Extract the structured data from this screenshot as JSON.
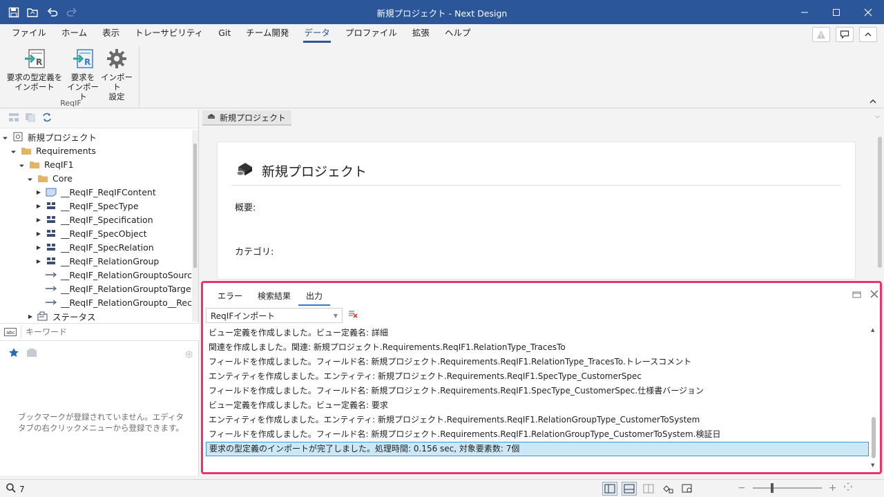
{
  "window": {
    "title": "新規プロジェクト - Next Design"
  },
  "qat": {
    "icons": [
      "save-icon",
      "open-project-icon",
      "undo-icon",
      "redo-icon"
    ]
  },
  "menu": {
    "tabs": [
      {
        "label": "ファイル"
      },
      {
        "label": "ホーム"
      },
      {
        "label": "表示"
      },
      {
        "label": "トレーサビリティ"
      },
      {
        "label": "Git"
      },
      {
        "label": "チーム開発"
      },
      {
        "label": "データ"
      },
      {
        "label": "プロファイル"
      },
      {
        "label": "拡張"
      },
      {
        "label": "ヘルプ"
      }
    ],
    "active": "データ"
  },
  "ribbon": {
    "group_label": "ReqIF",
    "commands": [
      {
        "line1": "要求の型定義を",
        "line2": "インポート"
      },
      {
        "line1": "要求を",
        "line2": "インポート"
      },
      {
        "line1": "インポート",
        "line2": "設定"
      }
    ]
  },
  "tree": {
    "items": [
      {
        "label": "新規プロジェクト",
        "level": 0,
        "expander": "open",
        "icon": "project-icon"
      },
      {
        "label": "Requirements",
        "level": 1,
        "expander": "open",
        "icon": "folder-icon"
      },
      {
        "label": "ReqIF1",
        "level": 2,
        "expander": "open",
        "icon": "folder-icon"
      },
      {
        "label": "Core",
        "level": 3,
        "expander": "open",
        "icon": "folder-icon"
      },
      {
        "label": "__ReqIF_ReqIFContent",
        "level": 4,
        "expander": "closed",
        "icon": "model-icon"
      },
      {
        "label": "__ReqIF_SpecType",
        "level": 4,
        "expander": "closed",
        "icon": "class-icon"
      },
      {
        "label": "__ReqIF_Specification",
        "level": 4,
        "expander": "closed",
        "icon": "class-icon"
      },
      {
        "label": "__ReqIF_SpecObject",
        "level": 4,
        "expander": "closed",
        "icon": "class-icon"
      },
      {
        "label": "__ReqIF_SpecRelation",
        "level": 4,
        "expander": "closed",
        "icon": "class-icon"
      },
      {
        "label": "__ReqIF_RelationGroup",
        "level": 4,
        "expander": "closed",
        "icon": "class-icon"
      },
      {
        "label": "__ReqIF_RelationGrouptoSourc",
        "level": 4,
        "expander": "none",
        "icon": "relation-icon"
      },
      {
        "label": "__ReqIF_RelationGrouptoTarge",
        "level": 4,
        "expander": "none",
        "icon": "relation-icon"
      },
      {
        "label": "__ReqIF_RelationGroupto__Rec",
        "level": 4,
        "expander": "none",
        "icon": "relation-icon"
      },
      {
        "label": "ステータス",
        "level": 3,
        "expander": "closed",
        "icon": "package-icon"
      }
    ]
  },
  "search": {
    "placeholder": "キーワード"
  },
  "bookmarks": {
    "empty_message": "ブックマークが登録されていません。エディタタブの右クリックメニューから登録できます。"
  },
  "editor": {
    "tab_label": "新規プロジェクト",
    "page_title": "新規プロジェクト",
    "fields": [
      {
        "label": "概要:"
      },
      {
        "label": "カテゴリ:"
      }
    ]
  },
  "output": {
    "tabs": [
      {
        "label": "エラー"
      },
      {
        "label": "検索結果"
      },
      {
        "label": "出力"
      }
    ],
    "active_tab": "出力",
    "source": "ReqIFインポート",
    "lines": [
      "ビュー定義を作成しました。ビュー定義名: 詳細",
      "関連を作成しました。関連: 新規プロジェクト.Requirements.ReqIF1.RelationType_TracesTo",
      "フィールドを作成しました。フィールド名: 新規プロジェクト.Requirements.ReqIF1.RelationType_TracesTo.トレースコメント",
      "エンティティを作成しました。エンティティ: 新規プロジェクト.Requirements.ReqIF1.SpecType_CustomerSpec",
      "フィールドを作成しました。フィールド名: 新規プロジェクト.Requirements.ReqIF1.SpecType_CustomerSpec.仕様書バージョン",
      "ビュー定義を作成しました。ビュー定義名: 要求",
      "エンティティを作成しました。エンティティ: 新規プロジェクト.Requirements.ReqIF1.RelationGroupType_CustomerToSystem",
      "フィールドを作成しました。フィールド名: 新規プロジェクト.Requirements.ReqIF1.RelationGroupType_CustomerToSystem.検証日",
      "要求の型定義のインポートが完了しました。処理時間: 0.156 sec, 対象要素数: 7個"
    ],
    "selected_line": 8
  },
  "status": {
    "search_count": "7"
  },
  "colors": {
    "titlebar": "#2b579a",
    "highlight": "#e8336b",
    "selection": "#cce8f6"
  }
}
